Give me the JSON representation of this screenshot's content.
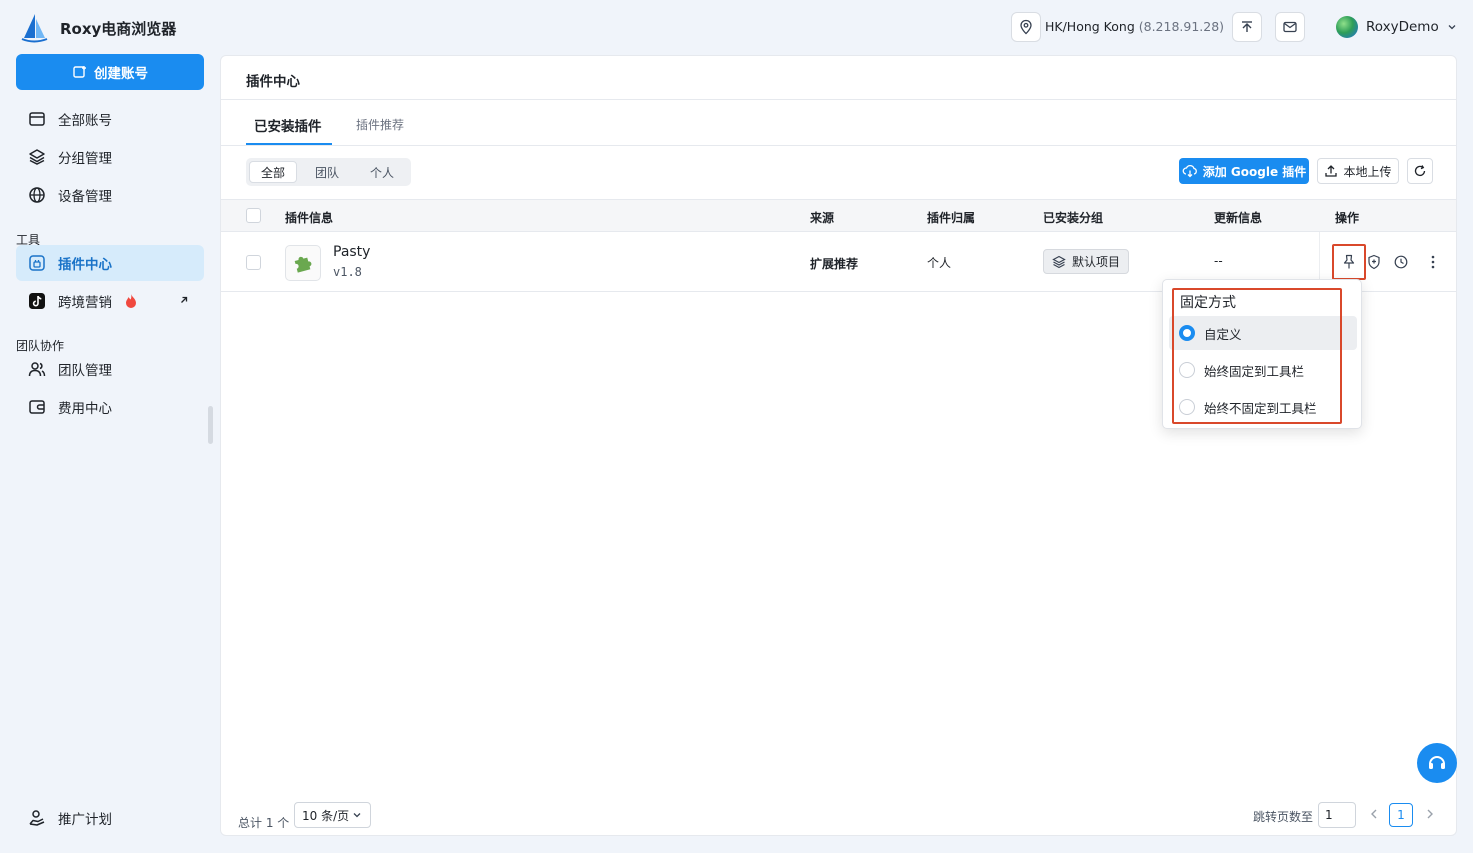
{
  "app": {
    "title": "Roxy电商浏览器"
  },
  "topbar": {
    "location": "HK/Hong Kong",
    "ip": "(8.218.91.28)",
    "user_name": "RoxyDemo"
  },
  "sidebar": {
    "create_label": "创建账号",
    "items": [
      {
        "label": "全部账号"
      },
      {
        "label": "分组管理"
      },
      {
        "label": "设备管理"
      }
    ],
    "section_tools": "工具",
    "tools": [
      {
        "label": "插件中心"
      },
      {
        "label": "跨境营销"
      }
    ],
    "section_team": "团队协作",
    "team": [
      {
        "label": "团队管理"
      },
      {
        "label": "费用中心"
      }
    ],
    "promo_label": "推广计划"
  },
  "main": {
    "title": "插件中心",
    "tabs": [
      {
        "label": "已安装插件"
      },
      {
        "label": "插件推荐"
      }
    ],
    "filters": [
      {
        "label": "全部"
      },
      {
        "label": "团队"
      },
      {
        "label": "个人"
      }
    ],
    "add_google_label": "添加 Google 插件",
    "upload_label": "本地上传",
    "columns": {
      "info": "插件信息",
      "source": "来源",
      "owner": "插件归属",
      "group": "已安装分组",
      "update": "更新信息",
      "ops": "操作"
    },
    "rows": [
      {
        "name": "Pasty",
        "version": "v1.8",
        "source": "扩展推荐",
        "owner": "个人",
        "group": "默认项目",
        "update": "--"
      }
    ],
    "footer": {
      "total": "总计 1 个",
      "page_size": "10 条/页",
      "jump_label": "跳转页数至",
      "jump_value": "1",
      "current_page": "1"
    }
  },
  "dropdown": {
    "title": "固定方式",
    "options": [
      {
        "label": "自定义",
        "checked": true
      },
      {
        "label": "始终固定到工具栏",
        "checked": false
      },
      {
        "label": "始终不固定到工具栏",
        "checked": false
      }
    ]
  },
  "colors": {
    "accent": "#1a8cf0",
    "highlight": "#d9482b"
  }
}
